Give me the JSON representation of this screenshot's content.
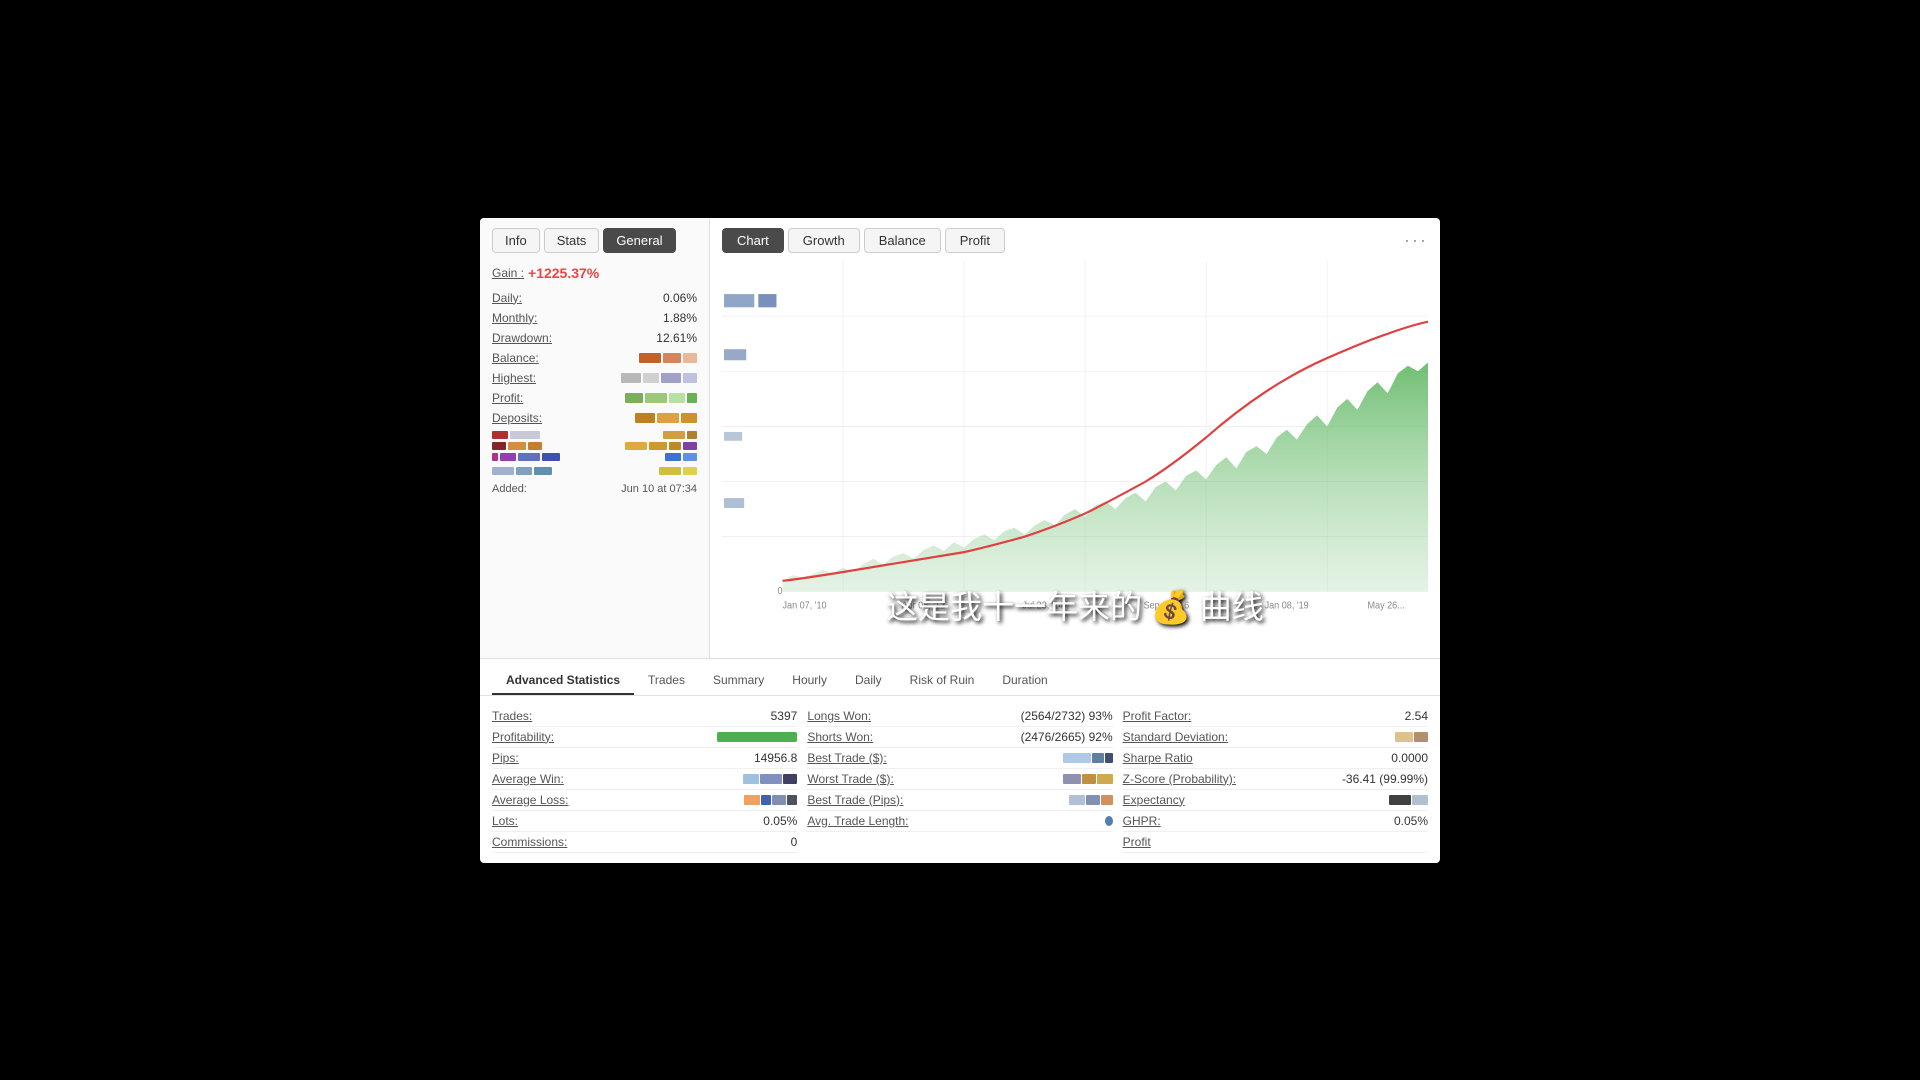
{
  "left_panel": {
    "tabs": [
      "Info",
      "Stats",
      "General"
    ],
    "active_tab": "General",
    "gain_label": "Gain :",
    "gain_value": "+1225.37%",
    "stats": [
      {
        "label": "Daily:",
        "value": "0.06%"
      },
      {
        "label": "Monthly:",
        "value": "1.88%"
      },
      {
        "label": "Drawdown:",
        "value": "12.61%"
      }
    ],
    "color_rows": [
      {
        "label": "Balance:",
        "bars": [
          "#c0622a",
          "#d4855e",
          "#e8b89a"
        ]
      },
      {
        "label": "Highest:",
        "bars": [
          "#b8b8b8",
          "#d0d0d0",
          "#a0a0c8",
          "#c0c0e0"
        ]
      },
      {
        "label": "Profit:",
        "bars": [
          "#7aad5c",
          "#9dc87a",
          "#b8e0a0",
          "#6ab054"
        ]
      },
      {
        "label": "Deposits:",
        "bars": [
          "#c08020",
          "#e0a040",
          "#d0902a"
        ]
      }
    ],
    "mini_colors": [
      [
        "#b03030",
        "#c0c0d0",
        "#d0d0e0",
        "#b0b0d0"
      ],
      [
        "#ffa060",
        "#d09040",
        "#c0c0c0"
      ],
      [
        "#803070",
        "#9040a0",
        "#6070c0",
        "#4050b0"
      ],
      [],
      [
        "#a0b0d0",
        "#80a0c0",
        "#6090b0"
      ]
    ],
    "mini_colors2": [
      [
        "#d0a040",
        "#e0b050",
        "#c0c040"
      ],
      [
        "#e0a040",
        "#d0b030",
        "#c0c050",
        "#b0a040"
      ],
      [
        "#4070d0",
        "#6090e0",
        "#8040c0"
      ]
    ],
    "added_label": "Added:",
    "added_value": "Jun 10 at 07:34"
  },
  "chart_panel": {
    "tabs": [
      "Chart",
      "Growth",
      "Balance",
      "Profit"
    ],
    "active_tab": "Chart",
    "more_icon": "···",
    "x_labels": [
      "Jan 07, '10",
      "Apr 05, '12",
      "Jul 23, '14",
      "Sep 28, '16",
      "Jan 08, '19",
      "May 26..."
    ],
    "zero_label": "0"
  },
  "bottom": {
    "tabs": [
      "Advanced Statistics",
      "Trades",
      "Summary",
      "Hourly",
      "Daily",
      "Risk of Ruin",
      "Duration"
    ],
    "active_tab": "Advanced Statistics",
    "stats_col1": [
      {
        "label": "Trades:",
        "value": "5397"
      },
      {
        "label": "Profitability:",
        "value": "bar"
      },
      {
        "label": "Pips:",
        "value": "14956.8"
      },
      {
        "label": "Average Win:",
        "value": "bars"
      },
      {
        "label": "Average Loss:",
        "value": "bars"
      },
      {
        "label": "Lots:",
        "value": "0.05%"
      },
      {
        "label": "Commissions:",
        "value": "0"
      }
    ],
    "stats_col2": [
      {
        "label": "Longs Won:",
        "value": "(2564/2732) 93%"
      },
      {
        "label": "Shorts Won:",
        "value": "(2476/2665) 92%"
      },
      {
        "label": "Best Trade ($):",
        "value": "bars"
      },
      {
        "label": "Worst Trade ($):",
        "value": "bars"
      },
      {
        "label": "Best Trade (Pips):",
        "value": "bars"
      },
      {
        "label": "Avg. Trade Length:",
        "value": "bar-dot"
      }
    ],
    "stats_col3": [
      {
        "label": "Profit Factor:",
        "value": "2.54"
      },
      {
        "label": "Standard Deviation:",
        "value": "bars"
      },
      {
        "label": "Sharpe Ratio",
        "value": "0.0000"
      },
      {
        "label": "Z-Score (Probability):",
        "value": "-36.41 (99.99%)"
      },
      {
        "label": "Expectancy",
        "value": "bars"
      },
      {
        "label": "GHPR:",
        "value": "0.05%"
      }
    ]
  },
  "subtitle": "这是我十一年来的 💰 曲线"
}
